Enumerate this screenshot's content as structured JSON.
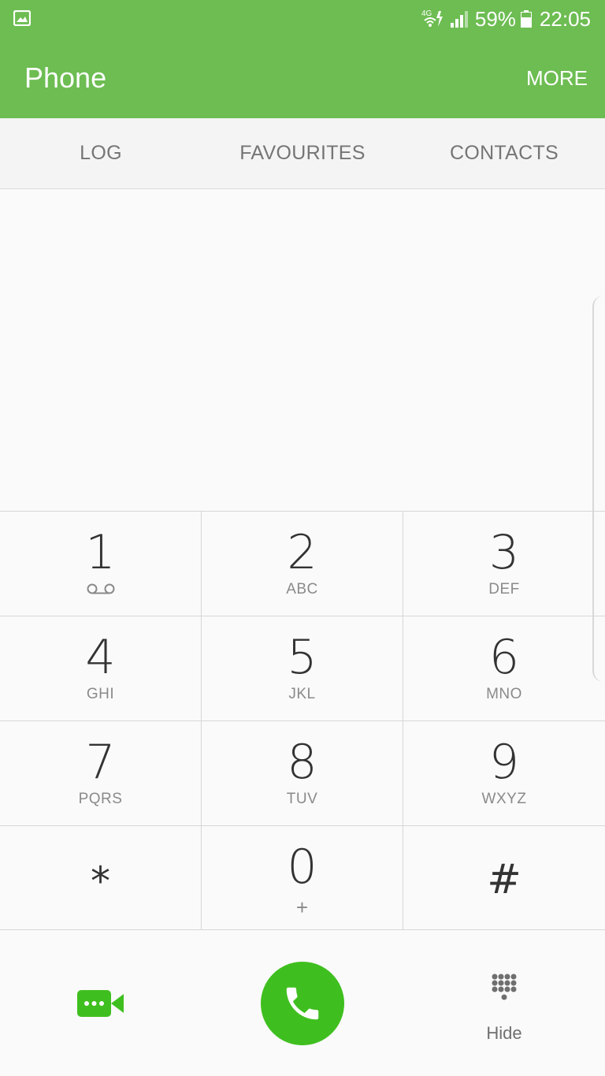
{
  "status_bar": {
    "network": "4G",
    "battery_percent": "59%",
    "time": "22:05"
  },
  "app_bar": {
    "title": "Phone",
    "more_label": "MORE"
  },
  "tabs": [
    {
      "label": "LOG"
    },
    {
      "label": "FAVOURITES"
    },
    {
      "label": "CONTACTS"
    }
  ],
  "keypad": {
    "keys": [
      {
        "digit": "1",
        "letters": ""
      },
      {
        "digit": "2",
        "letters": "ABC"
      },
      {
        "digit": "3",
        "letters": "DEF"
      },
      {
        "digit": "4",
        "letters": "GHI"
      },
      {
        "digit": "5",
        "letters": "JKL"
      },
      {
        "digit": "6",
        "letters": "MNO"
      },
      {
        "digit": "7",
        "letters": "PQRS"
      },
      {
        "digit": "8",
        "letters": "TUV"
      },
      {
        "digit": "9",
        "letters": "WXYZ"
      },
      {
        "digit": "*",
        "letters": ""
      },
      {
        "digit": "0",
        "letters": "+"
      },
      {
        "digit": "#",
        "letters": ""
      }
    ]
  },
  "actions": {
    "hide_label": "Hide"
  },
  "colors": {
    "accent": "#6dbd52",
    "call_button": "#3fbf1f",
    "video_icon": "#3fbf1f"
  },
  "icons": {
    "status": [
      "gallery-icon",
      "wifi-icon",
      "signal-icon",
      "battery-icon"
    ],
    "actions": [
      "video-call-icon",
      "phone-icon",
      "dialpad-icon"
    ]
  }
}
